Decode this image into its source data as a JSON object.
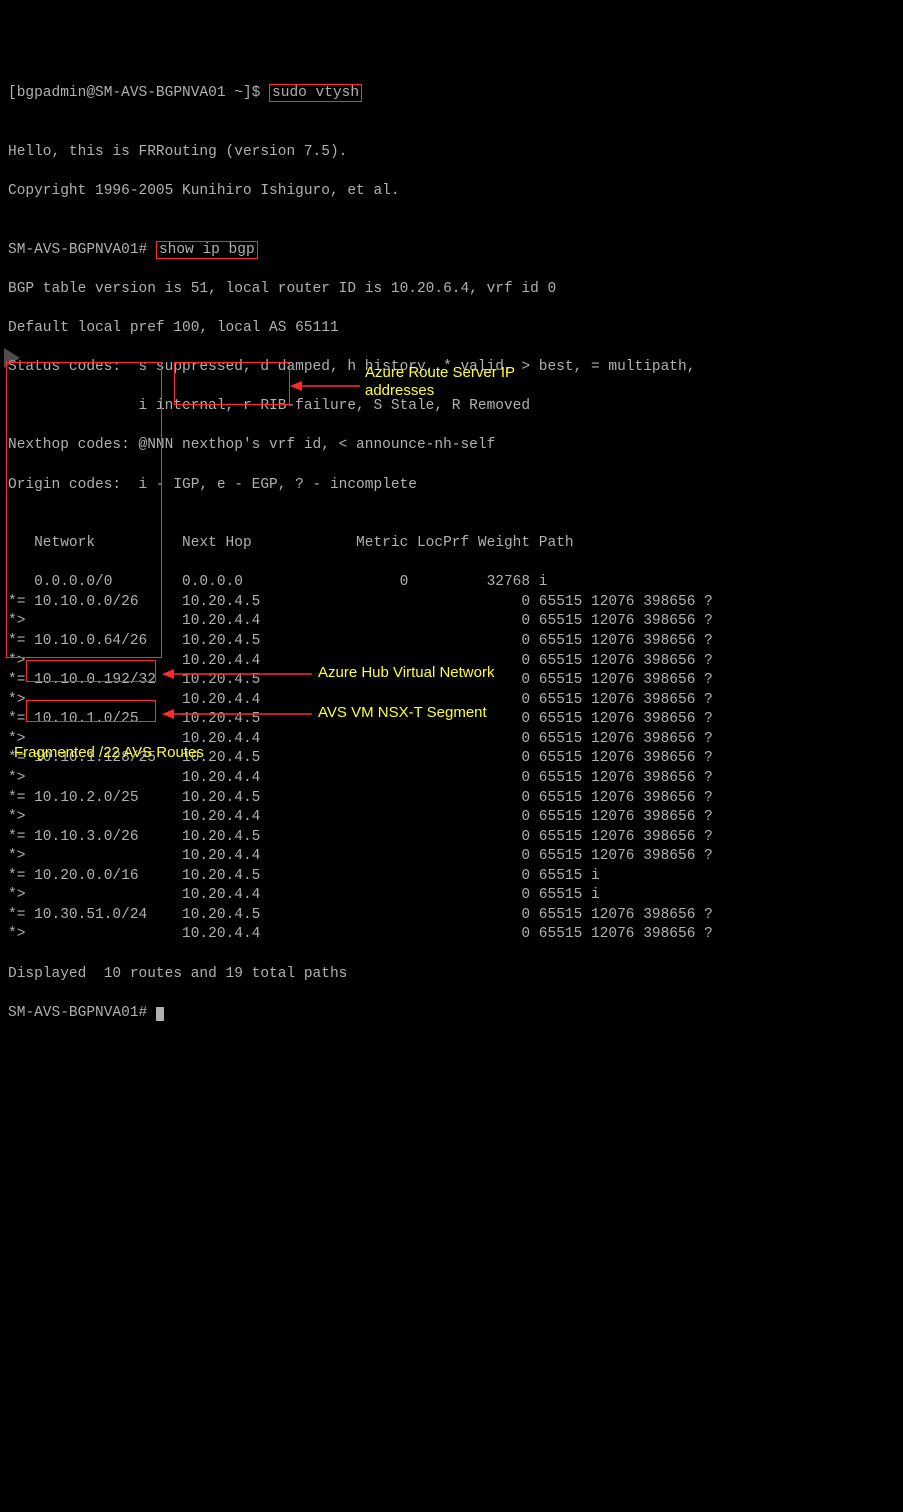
{
  "prompt1_user": "[bgpadmin@SM-AVS-BGPNVA01 ~]$ ",
  "cmd1": "sudo vtysh",
  "blank": "",
  "hello1": "Hello, this is FRRouting (version 7.5).",
  "hello2": "Copyright 1996-2005 Kunihiro Ishiguro, et al.",
  "prompt2": "SM-AVS-BGPNVA01# ",
  "cmd2": "show ip bgp",
  "bgp1": "BGP table version is 51, local router ID is 10.20.6.4, vrf id 0",
  "bgp2": "Default local pref 100, local AS 65111",
  "bgp3": "Status codes:  s suppressed, d damped, h history, * valid, > best, = multipath,",
  "bgp4": "               i internal, r RIB-failure, S Stale, R Removed",
  "bgp5": "Nexthop codes: @NNN nexthop's vrf id, < announce-nh-self",
  "bgp6": "Origin codes:  i - IGP, e - EGP, ? - incomplete",
  "hdr": "   Network          Next Hop            Metric LocPrf Weight Path",
  "rows": [
    "   0.0.0.0/0        0.0.0.0                  0         32768 i",
    "*= 10.10.0.0/26     10.20.4.5                              0 65515 12076 398656 ?",
    "*>                  10.20.4.4                              0 65515 12076 398656 ?",
    "*= 10.10.0.64/26    10.20.4.5                              0 65515 12076 398656 ?",
    "*>                  10.20.4.4                              0 65515 12076 398656 ?",
    "*= 10.10.0.192/32   10.20.4.5                              0 65515 12076 398656 ?",
    "*>                  10.20.4.4                              0 65515 12076 398656 ?",
    "*= 10.10.1.0/25     10.20.4.5                              0 65515 12076 398656 ?",
    "*>                  10.20.4.4                              0 65515 12076 398656 ?",
    "*= 10.10.1.128/25   10.20.4.5                              0 65515 12076 398656 ?",
    "*>                  10.20.4.4                              0 65515 12076 398656 ?",
    "*= 10.10.2.0/25     10.20.4.5                              0 65515 12076 398656 ?",
    "*>                  10.20.4.4                              0 65515 12076 398656 ?",
    "*= 10.10.3.0/26     10.20.4.5                              0 65515 12076 398656 ?",
    "*>                  10.20.4.4                              0 65515 12076 398656 ?",
    "*= 10.20.0.0/16     10.20.4.5                              0 65515 i",
    "*>                  10.20.4.4                              0 65515 i",
    "*= 10.30.51.0/24    10.20.4.5                              0 65515 12076 398656 ?",
    "*>                  10.20.4.4                              0 65515 12076 398656 ?"
  ],
  "disp": "Displayed  10 routes and 19 total paths",
  "prompt3": "SM-AVS-BGPNVA01# ",
  "ann": {
    "route_server": "Azure Route Server\nIP addresses",
    "hub_vnet": "Azure Hub Virtual Network",
    "nsx_seg": "AVS VM NSX-T Segment",
    "frag": "Fragmented /22 AVS Routes"
  },
  "chart_data": {
    "type": "table",
    "title": "show ip bgp",
    "columns": [
      "Status",
      "Network",
      "Next Hop",
      "Metric",
      "LocPrf",
      "Weight",
      "Path"
    ],
    "rows": [
      {
        "status": "",
        "network": "0.0.0.0/0",
        "next_hop": "0.0.0.0",
        "metric": 0,
        "locprf": null,
        "weight": 32768,
        "path": "i"
      },
      {
        "status": "*=",
        "network": "10.10.0.0/26",
        "next_hop": "10.20.4.5",
        "metric": null,
        "locprf": null,
        "weight": 0,
        "path": "65515 12076 398656 ?"
      },
      {
        "status": "*>",
        "network": "10.10.0.0/26",
        "next_hop": "10.20.4.4",
        "metric": null,
        "locprf": null,
        "weight": 0,
        "path": "65515 12076 398656 ?"
      },
      {
        "status": "*=",
        "network": "10.10.0.64/26",
        "next_hop": "10.20.4.5",
        "metric": null,
        "locprf": null,
        "weight": 0,
        "path": "65515 12076 398656 ?"
      },
      {
        "status": "*>",
        "network": "10.10.0.64/26",
        "next_hop": "10.20.4.4",
        "metric": null,
        "locprf": null,
        "weight": 0,
        "path": "65515 12076 398656 ?"
      },
      {
        "status": "*=",
        "network": "10.10.0.192/32",
        "next_hop": "10.20.4.5",
        "metric": null,
        "locprf": null,
        "weight": 0,
        "path": "65515 12076 398656 ?"
      },
      {
        "status": "*>",
        "network": "10.10.0.192/32",
        "next_hop": "10.20.4.4",
        "metric": null,
        "locprf": null,
        "weight": 0,
        "path": "65515 12076 398656 ?"
      },
      {
        "status": "*=",
        "network": "10.10.1.0/25",
        "next_hop": "10.20.4.5",
        "metric": null,
        "locprf": null,
        "weight": 0,
        "path": "65515 12076 398656 ?"
      },
      {
        "status": "*>",
        "network": "10.10.1.0/25",
        "next_hop": "10.20.4.4",
        "metric": null,
        "locprf": null,
        "weight": 0,
        "path": "65515 12076 398656 ?"
      },
      {
        "status": "*=",
        "network": "10.10.1.128/25",
        "next_hop": "10.20.4.5",
        "metric": null,
        "locprf": null,
        "weight": 0,
        "path": "65515 12076 398656 ?"
      },
      {
        "status": "*>",
        "network": "10.10.1.128/25",
        "next_hop": "10.20.4.4",
        "metric": null,
        "locprf": null,
        "weight": 0,
        "path": "65515 12076 398656 ?"
      },
      {
        "status": "*=",
        "network": "10.10.2.0/25",
        "next_hop": "10.20.4.5",
        "metric": null,
        "locprf": null,
        "weight": 0,
        "path": "65515 12076 398656 ?"
      },
      {
        "status": "*>",
        "network": "10.10.2.0/25",
        "next_hop": "10.20.4.4",
        "metric": null,
        "locprf": null,
        "weight": 0,
        "path": "65515 12076 398656 ?"
      },
      {
        "status": "*=",
        "network": "10.10.3.0/26",
        "next_hop": "10.20.4.5",
        "metric": null,
        "locprf": null,
        "weight": 0,
        "path": "65515 12076 398656 ?"
      },
      {
        "status": "*>",
        "network": "10.10.3.0/26",
        "next_hop": "10.20.4.4",
        "metric": null,
        "locprf": null,
        "weight": 0,
        "path": "65515 12076 398656 ?"
      },
      {
        "status": "*=",
        "network": "10.20.0.0/16",
        "next_hop": "10.20.4.5",
        "metric": null,
        "locprf": null,
        "weight": 0,
        "path": "65515 i"
      },
      {
        "status": "*>",
        "network": "10.20.0.0/16",
        "next_hop": "10.20.4.4",
        "metric": null,
        "locprf": null,
        "weight": 0,
        "path": "65515 i"
      },
      {
        "status": "*=",
        "network": "10.30.51.0/24",
        "next_hop": "10.20.4.5",
        "metric": null,
        "locprf": null,
        "weight": 0,
        "path": "65515 12076 398656 ?"
      },
      {
        "status": "*>",
        "network": "10.30.51.0/24",
        "next_hop": "10.20.4.4",
        "metric": null,
        "locprf": null,
        "weight": 0,
        "path": "65515 12076 398656 ?"
      }
    ],
    "summary": {
      "displayed_routes": 10,
      "total_paths": 19
    }
  }
}
